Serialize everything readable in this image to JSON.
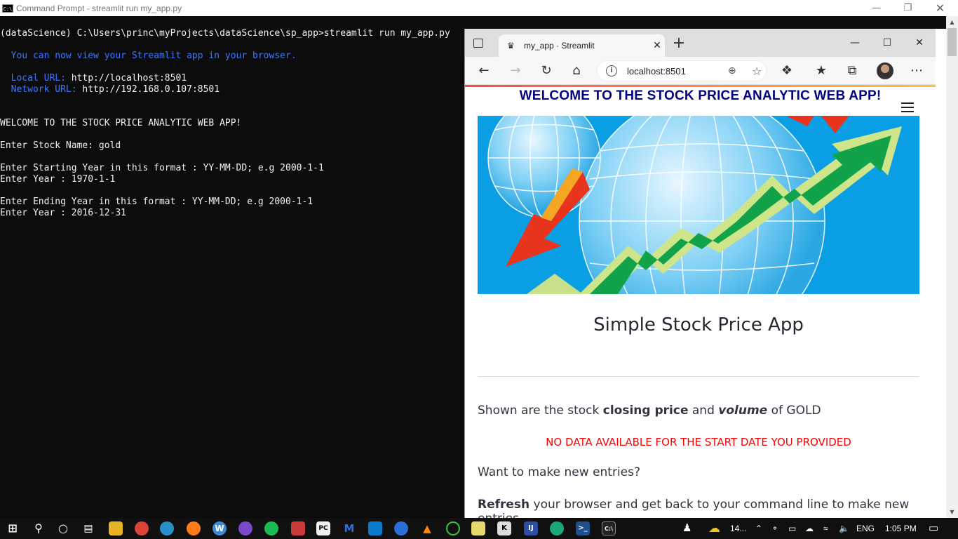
{
  "cmd": {
    "window_title": "Command Prompt - streamlit  run my_app.py",
    "lines": [
      {
        "text": "(dataScience) C:\\Users\\princ\\myProjects\\dataScience\\sp_app>streamlit run my_app.py",
        "style": "white"
      },
      {
        "text": "",
        "style": ""
      },
      {
        "text": "  You can now view your Streamlit app in your browser.",
        "style": "blue"
      },
      {
        "text": "",
        "style": ""
      },
      {
        "label": "  Local URL: ",
        "value": "http://localhost:8501"
      },
      {
        "label": "  Network URL: ",
        "value": "http://192.168.0.107:8501"
      },
      {
        "text": "",
        "style": ""
      },
      {
        "text": "",
        "style": ""
      },
      {
        "text": "WELCOME TO THE STOCK PRICE ANALYTIC WEB APP!",
        "style": "white"
      },
      {
        "text": "",
        "style": ""
      },
      {
        "text": "Enter Stock Name: gold",
        "style": "white"
      },
      {
        "text": "",
        "style": ""
      },
      {
        "text": "Enter Starting Year in this format : YY-MM-DD; e.g 2000-1-1",
        "style": "white"
      },
      {
        "text": "Enter Year : 1970-1-1",
        "style": "white"
      },
      {
        "text": "",
        "style": ""
      },
      {
        "text": "Enter Ending Year in this format : YY-MM-DD; e.g 2000-1-1",
        "style": "white"
      },
      {
        "text": "Enter Year : 2016-12-31",
        "style": "white"
      }
    ]
  },
  "browser": {
    "tab_title": "my_app · Streamlit",
    "url": "localhost:8501"
  },
  "app": {
    "header": "WELCOME TO THE STOCK PRICE ANALYTIC WEB APP!",
    "title": "Simple Stock Price App",
    "shown_prefix": "Shown are the stock ",
    "shown_bold": "closing price",
    "shown_mid": " and ",
    "shown_italic": "volume",
    "shown_suffix": " of GOLD",
    "warning": "NO DATA AVAILABLE FOR THE START DATE YOU PROVIDED",
    "question": "Want to make new entries?",
    "refresh_bold": "Refresh",
    "refresh_rest": " your browser and get back to your command line to make new entries."
  },
  "taskbar": {
    "weather": "14...",
    "language": "ENG",
    "time": "1:05 PM"
  },
  "colors": {
    "header_navy": "#000080",
    "warning_red": "#ff0000",
    "terminal_blue": "#3b78ff"
  }
}
